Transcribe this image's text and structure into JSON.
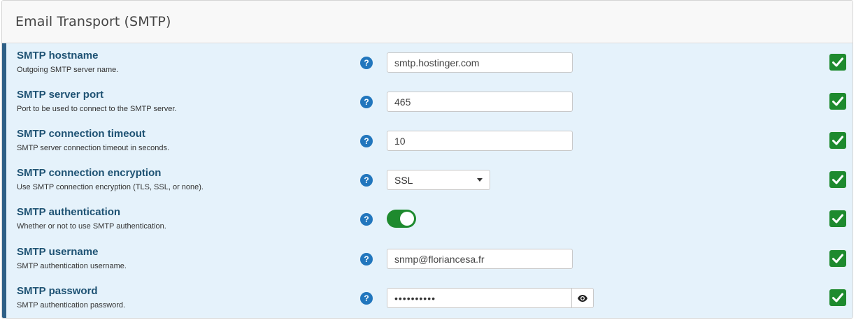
{
  "panel": {
    "title": "Email Transport (SMTP)"
  },
  "settings": [
    {
      "label": "SMTP hostname",
      "description": "Outgoing SMTP server name.",
      "type": "text",
      "value": "smtp.hostinger.com"
    },
    {
      "label": "SMTP server port",
      "description": "Port to be used to connect to the SMTP server.",
      "type": "text",
      "value": "465"
    },
    {
      "label": "SMTP connection timeout",
      "description": "SMTP server connection timeout in seconds.",
      "type": "text",
      "value": "10"
    },
    {
      "label": "SMTP connection encryption",
      "description": "Use SMTP connection encryption (TLS, SSL, or none).",
      "type": "select",
      "value": "SSL"
    },
    {
      "label": "SMTP authentication",
      "description": "Whether or not to use SMTP authentication.",
      "type": "toggle",
      "value": true
    },
    {
      "label": "SMTP username",
      "description": "SMTP authentication username.",
      "type": "text",
      "value": "snmp@floriancesa.fr"
    },
    {
      "label": "SMTP password",
      "description": "SMTP authentication password.",
      "type": "password",
      "value": "••••••••••"
    }
  ],
  "icons": {
    "help": "question-circle-icon",
    "valid": "check-square-icon",
    "reveal": "eye-icon",
    "dropdown": "chevron-down-icon"
  },
  "colors": {
    "accent_bar": "#2e5f86",
    "body_bg": "#e5f2fb",
    "label": "#1e5273",
    "help": "#2176bd",
    "success": "#1e8a2e"
  },
  "help_glyph": "?"
}
